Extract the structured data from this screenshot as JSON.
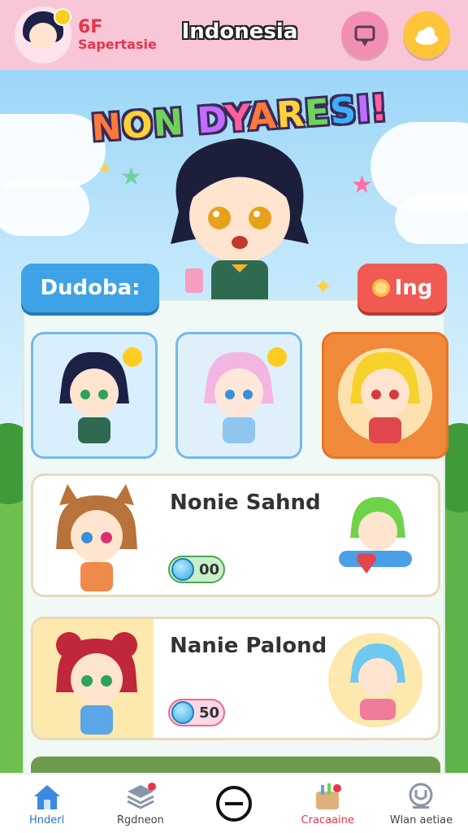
{
  "header": {
    "level": "6F",
    "subtitle": "Sapertasie",
    "region": "Indonesia",
    "chat_icon": "chat-bubble-icon",
    "cloud_icon": "cloud-icon"
  },
  "banner": {
    "title": "NON DYARESI!"
  },
  "tags": {
    "left_label": "Dudoba:",
    "right_label": "Ing",
    "right_icon": "magnifier-icon"
  },
  "list": [
    {
      "name": "Nonie Sahnd",
      "count": "00"
    },
    {
      "name": "Nanie Palond",
      "count": "50"
    }
  ],
  "nav": [
    {
      "label": "Hnderl",
      "icon": "home-icon"
    },
    {
      "label": "Rgdneon",
      "icon": "stack-icon"
    },
    {
      "label": "",
      "icon": "minus-circle-icon"
    },
    {
      "label": "Cracaaine",
      "icon": "shop-bag-icon"
    },
    {
      "label": "Wlan aetiae",
      "icon": "profile-icon"
    }
  ],
  "colors": {
    "header_bg": "#f9c6d7",
    "accent_red": "#e8344b",
    "tag_blue": "#3ea3e6",
    "tag_red": "#f05a52"
  }
}
